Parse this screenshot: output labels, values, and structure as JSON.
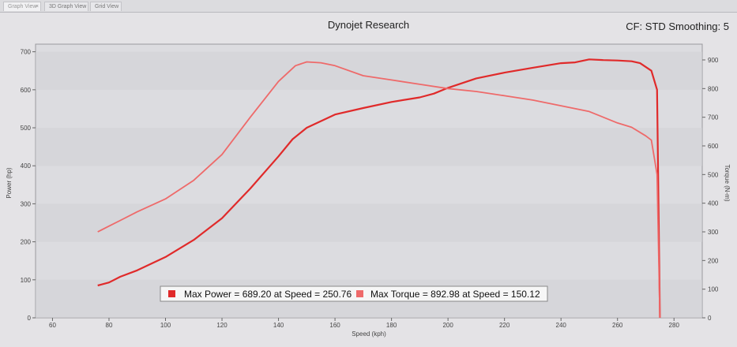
{
  "tabs": [
    {
      "label": "Graph View",
      "active": true
    },
    {
      "label": "3D Graph View",
      "active": false
    },
    {
      "label": "Grid View",
      "active": false
    }
  ],
  "header": {
    "title": "Dynojet Research",
    "right_info": "CF: STD Smoothing: 5"
  },
  "colors": {
    "power": "#e02a2a",
    "torque": "#ee6a6a",
    "plot_bg": "#dcdce0",
    "band_bg": "#d2d2d6",
    "border": "#9a9a9e"
  },
  "chart_data": {
    "type": "line",
    "title": "Dynojet Research",
    "xlabel": "Speed (kph)",
    "ylabel": "Power (hp)",
    "y2label": "Torque (N-m)",
    "xlim": [
      54,
      290
    ],
    "ylim": [
      0,
      720
    ],
    "y2lim": [
      0,
      955
    ],
    "xticks": [
      60,
      80,
      100,
      120,
      140,
      160,
      180,
      200,
      220,
      240,
      260,
      280
    ],
    "yticks": [
      0,
      100,
      200,
      300,
      400,
      500,
      600,
      700
    ],
    "y2ticks": [
      0,
      100,
      200,
      300,
      400,
      500,
      600,
      700,
      800,
      900
    ],
    "grid": "horizontal bands",
    "legend_position": "bottom-center",
    "legend": [
      {
        "swatch": "power",
        "text": "Max Power = 689.20 at Speed = 250.76"
      },
      {
        "swatch": "torque",
        "text": "Max Torque = 892.98 at Speed = 150.12"
      }
    ],
    "series": [
      {
        "name": "Power",
        "axis": "left",
        "x": [
          76,
          80,
          84,
          90,
          100,
          110,
          120,
          130,
          140,
          145,
          150,
          160,
          170,
          180,
          190,
          195,
          200,
          210,
          220,
          230,
          240,
          245,
          250,
          255,
          260,
          265,
          268,
          272,
          274,
          275
        ],
        "y": [
          85,
          93,
          108,
          125,
          160,
          205,
          262,
          340,
          425,
          470,
          500,
          535,
          552,
          568,
          580,
          590,
          605,
          630,
          645,
          658,
          670,
          672,
          680,
          678,
          677,
          675,
          670,
          650,
          600,
          0
        ]
      },
      {
        "name": "Torque",
        "axis": "right",
        "x": [
          76,
          80,
          84,
          90,
          100,
          110,
          120,
          130,
          140,
          146,
          150,
          155,
          160,
          170,
          180,
          190,
          200,
          210,
          220,
          230,
          240,
          250,
          260,
          265,
          270,
          272,
          274,
          275
        ],
        "y": [
          300,
          320,
          340,
          370,
          415,
          480,
          570,
          700,
          825,
          880,
          893,
          890,
          880,
          845,
          830,
          815,
          800,
          790,
          775,
          760,
          740,
          720,
          680,
          665,
          635,
          620,
          500,
          0
        ]
      }
    ]
  }
}
